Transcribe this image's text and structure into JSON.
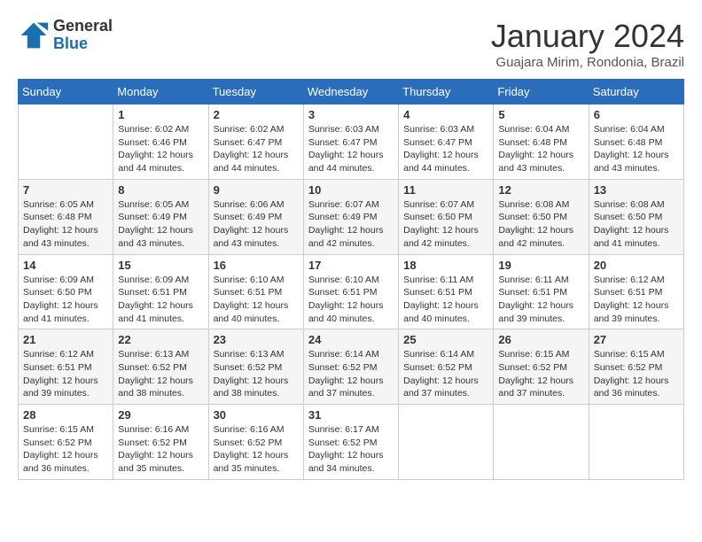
{
  "logo": {
    "general": "General",
    "blue": "Blue"
  },
  "title": "January 2024",
  "subtitle": "Guajara Mirim, Rondonia, Brazil",
  "weekdays": [
    "Sunday",
    "Monday",
    "Tuesday",
    "Wednesday",
    "Thursday",
    "Friday",
    "Saturday"
  ],
  "weeks": [
    [
      {
        "day": "",
        "sunrise": "",
        "sunset": "",
        "daylight": ""
      },
      {
        "day": "1",
        "sunrise": "Sunrise: 6:02 AM",
        "sunset": "Sunset: 6:46 PM",
        "daylight": "Daylight: 12 hours and 44 minutes."
      },
      {
        "day": "2",
        "sunrise": "Sunrise: 6:02 AM",
        "sunset": "Sunset: 6:47 PM",
        "daylight": "Daylight: 12 hours and 44 minutes."
      },
      {
        "day": "3",
        "sunrise": "Sunrise: 6:03 AM",
        "sunset": "Sunset: 6:47 PM",
        "daylight": "Daylight: 12 hours and 44 minutes."
      },
      {
        "day": "4",
        "sunrise": "Sunrise: 6:03 AM",
        "sunset": "Sunset: 6:47 PM",
        "daylight": "Daylight: 12 hours and 44 minutes."
      },
      {
        "day": "5",
        "sunrise": "Sunrise: 6:04 AM",
        "sunset": "Sunset: 6:48 PM",
        "daylight": "Daylight: 12 hours and 43 minutes."
      },
      {
        "day": "6",
        "sunrise": "Sunrise: 6:04 AM",
        "sunset": "Sunset: 6:48 PM",
        "daylight": "Daylight: 12 hours and 43 minutes."
      }
    ],
    [
      {
        "day": "7",
        "sunrise": "Sunrise: 6:05 AM",
        "sunset": "Sunset: 6:48 PM",
        "daylight": "Daylight: 12 hours and 43 minutes."
      },
      {
        "day": "8",
        "sunrise": "Sunrise: 6:05 AM",
        "sunset": "Sunset: 6:49 PM",
        "daylight": "Daylight: 12 hours and 43 minutes."
      },
      {
        "day": "9",
        "sunrise": "Sunrise: 6:06 AM",
        "sunset": "Sunset: 6:49 PM",
        "daylight": "Daylight: 12 hours and 43 minutes."
      },
      {
        "day": "10",
        "sunrise": "Sunrise: 6:07 AM",
        "sunset": "Sunset: 6:49 PM",
        "daylight": "Daylight: 12 hours and 42 minutes."
      },
      {
        "day": "11",
        "sunrise": "Sunrise: 6:07 AM",
        "sunset": "Sunset: 6:50 PM",
        "daylight": "Daylight: 12 hours and 42 minutes."
      },
      {
        "day": "12",
        "sunrise": "Sunrise: 6:08 AM",
        "sunset": "Sunset: 6:50 PM",
        "daylight": "Daylight: 12 hours and 42 minutes."
      },
      {
        "day": "13",
        "sunrise": "Sunrise: 6:08 AM",
        "sunset": "Sunset: 6:50 PM",
        "daylight": "Daylight: 12 hours and 41 minutes."
      }
    ],
    [
      {
        "day": "14",
        "sunrise": "Sunrise: 6:09 AM",
        "sunset": "Sunset: 6:50 PM",
        "daylight": "Daylight: 12 hours and 41 minutes."
      },
      {
        "day": "15",
        "sunrise": "Sunrise: 6:09 AM",
        "sunset": "Sunset: 6:51 PM",
        "daylight": "Daylight: 12 hours and 41 minutes."
      },
      {
        "day": "16",
        "sunrise": "Sunrise: 6:10 AM",
        "sunset": "Sunset: 6:51 PM",
        "daylight": "Daylight: 12 hours and 40 minutes."
      },
      {
        "day": "17",
        "sunrise": "Sunrise: 6:10 AM",
        "sunset": "Sunset: 6:51 PM",
        "daylight": "Daylight: 12 hours and 40 minutes."
      },
      {
        "day": "18",
        "sunrise": "Sunrise: 6:11 AM",
        "sunset": "Sunset: 6:51 PM",
        "daylight": "Daylight: 12 hours and 40 minutes."
      },
      {
        "day": "19",
        "sunrise": "Sunrise: 6:11 AM",
        "sunset": "Sunset: 6:51 PM",
        "daylight": "Daylight: 12 hours and 39 minutes."
      },
      {
        "day": "20",
        "sunrise": "Sunrise: 6:12 AM",
        "sunset": "Sunset: 6:51 PM",
        "daylight": "Daylight: 12 hours and 39 minutes."
      }
    ],
    [
      {
        "day": "21",
        "sunrise": "Sunrise: 6:12 AM",
        "sunset": "Sunset: 6:51 PM",
        "daylight": "Daylight: 12 hours and 39 minutes."
      },
      {
        "day": "22",
        "sunrise": "Sunrise: 6:13 AM",
        "sunset": "Sunset: 6:52 PM",
        "daylight": "Daylight: 12 hours and 38 minutes."
      },
      {
        "day": "23",
        "sunrise": "Sunrise: 6:13 AM",
        "sunset": "Sunset: 6:52 PM",
        "daylight": "Daylight: 12 hours and 38 minutes."
      },
      {
        "day": "24",
        "sunrise": "Sunrise: 6:14 AM",
        "sunset": "Sunset: 6:52 PM",
        "daylight": "Daylight: 12 hours and 37 minutes."
      },
      {
        "day": "25",
        "sunrise": "Sunrise: 6:14 AM",
        "sunset": "Sunset: 6:52 PM",
        "daylight": "Daylight: 12 hours and 37 minutes."
      },
      {
        "day": "26",
        "sunrise": "Sunrise: 6:15 AM",
        "sunset": "Sunset: 6:52 PM",
        "daylight": "Daylight: 12 hours and 37 minutes."
      },
      {
        "day": "27",
        "sunrise": "Sunrise: 6:15 AM",
        "sunset": "Sunset: 6:52 PM",
        "daylight": "Daylight: 12 hours and 36 minutes."
      }
    ],
    [
      {
        "day": "28",
        "sunrise": "Sunrise: 6:15 AM",
        "sunset": "Sunset: 6:52 PM",
        "daylight": "Daylight: 12 hours and 36 minutes."
      },
      {
        "day": "29",
        "sunrise": "Sunrise: 6:16 AM",
        "sunset": "Sunset: 6:52 PM",
        "daylight": "Daylight: 12 hours and 35 minutes."
      },
      {
        "day": "30",
        "sunrise": "Sunrise: 6:16 AM",
        "sunset": "Sunset: 6:52 PM",
        "daylight": "Daylight: 12 hours and 35 minutes."
      },
      {
        "day": "31",
        "sunrise": "Sunrise: 6:17 AM",
        "sunset": "Sunset: 6:52 PM",
        "daylight": "Daylight: 12 hours and 34 minutes."
      },
      {
        "day": "",
        "sunrise": "",
        "sunset": "",
        "daylight": ""
      },
      {
        "day": "",
        "sunrise": "",
        "sunset": "",
        "daylight": ""
      },
      {
        "day": "",
        "sunrise": "",
        "sunset": "",
        "daylight": ""
      }
    ]
  ]
}
